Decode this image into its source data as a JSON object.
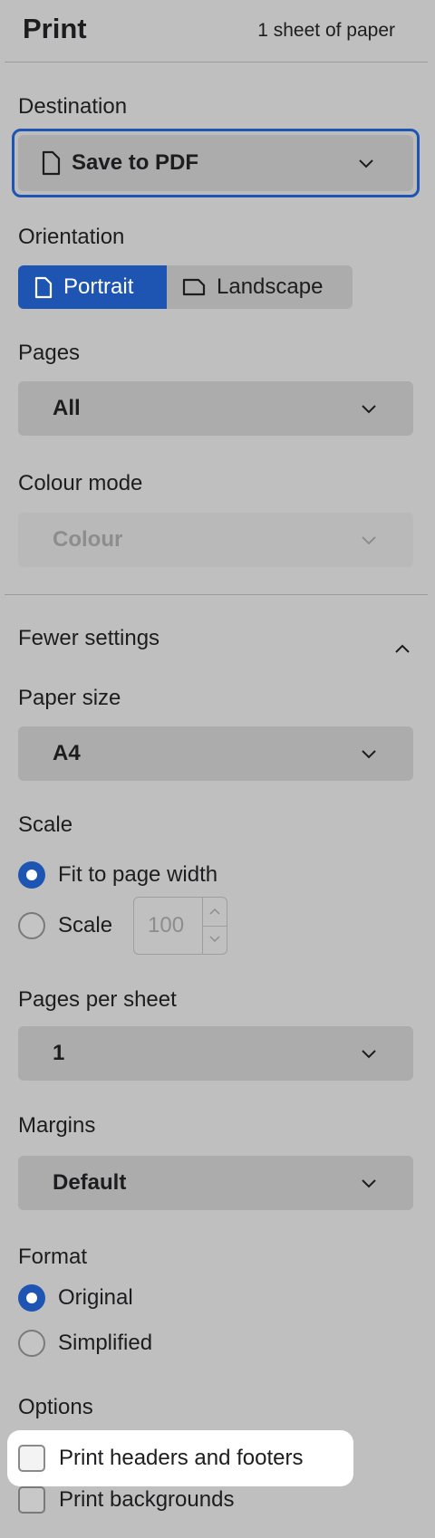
{
  "header": {
    "title": "Print",
    "sheet_count": "1 sheet of paper"
  },
  "destination": {
    "label": "Destination",
    "value": "Save to PDF",
    "icon": "document-icon"
  },
  "orientation": {
    "label": "Orientation",
    "options": [
      {
        "label": "Portrait",
        "selected": true
      },
      {
        "label": "Landscape",
        "selected": false
      }
    ]
  },
  "pages": {
    "label": "Pages",
    "value": "All"
  },
  "colour_mode": {
    "label": "Colour mode",
    "value": "Colour",
    "disabled": true
  },
  "more_settings": {
    "label": "Fewer settings",
    "expanded": true
  },
  "paper_size": {
    "label": "Paper size",
    "value": "A4"
  },
  "scale": {
    "label": "Scale",
    "options": [
      {
        "label": "Fit to page width",
        "selected": true
      },
      {
        "label": "Scale",
        "selected": false
      }
    ],
    "custom_value": "100"
  },
  "pages_per_sheet": {
    "label": "Pages per sheet",
    "value": "1"
  },
  "margins": {
    "label": "Margins",
    "value": "Default"
  },
  "format": {
    "label": "Format",
    "options": [
      {
        "label": "Original",
        "selected": true
      },
      {
        "label": "Simplified",
        "selected": false
      }
    ]
  },
  "options": {
    "label": "Options",
    "items": [
      {
        "label": "Print headers and footers",
        "checked": false,
        "highlighted": true
      },
      {
        "label": "Print backgrounds",
        "checked": false
      }
    ]
  },
  "colors": {
    "accent": "#1e55b3",
    "background": "#bfbfbf",
    "control": "#acacac",
    "highlight": "#ffffff"
  }
}
